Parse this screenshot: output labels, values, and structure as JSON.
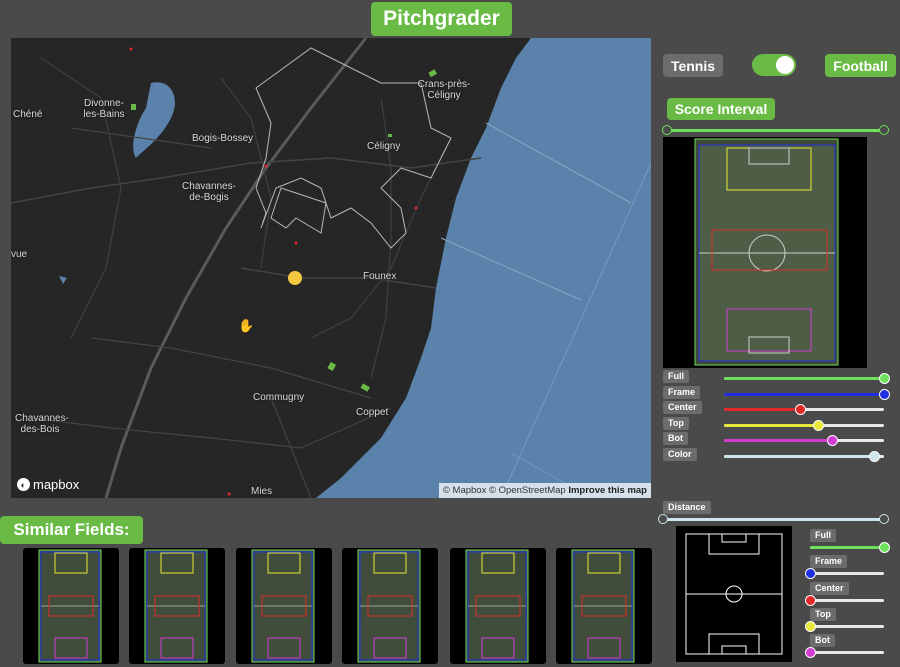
{
  "app": {
    "title": "Pitchgrader"
  },
  "map": {
    "labels": [
      "Chéné",
      "Divonne-les-Bains",
      "Bogis-Bossey",
      "Chavannes-de-Bogis",
      "Crans-près-Céligny",
      "Céligny",
      "vue",
      "Founex",
      "Commugny",
      "Coppet",
      "Chavannes-des-Bois",
      "Mies"
    ],
    "logo": "mapbox",
    "attribution": "© Mapbox © OpenStreetMap",
    "improve_link": "Improve this map",
    "colors": {
      "land": "#262626",
      "water": "#5a82aa",
      "field": "#6abb45",
      "marker": "#f5c842",
      "road": "#555555"
    }
  },
  "sport_toggle": {
    "left_label": "Tennis",
    "right_label": "Football",
    "selected": "Football"
  },
  "score_interval": {
    "label": "Score Interval",
    "range": [
      0,
      1
    ]
  },
  "filters": [
    {
      "label": "Full",
      "color": "#6ee05a",
      "value": 1.0
    },
    {
      "label": "Frame",
      "color": "#1f2ee0",
      "value": 1.0
    },
    {
      "label": "Center",
      "color": "#e02a2a",
      "value": 0.48
    },
    {
      "label": "Top",
      "color": "#e8e83a",
      "value": 0.59
    },
    {
      "label": "Bot",
      "color": "#d23bd2",
      "value": 0.68
    },
    {
      "label": "Color",
      "color": "#cfe6ee",
      "value": 0.94
    }
  ],
  "similar_fields": {
    "label": "Similar Fields:",
    "count": 6
  },
  "distance": {
    "label": "Distance",
    "range": [
      0,
      1
    ],
    "weights": [
      {
        "label": "Full",
        "color": "#6ee05a",
        "value": 1.0
      },
      {
        "label": "Frame",
        "color": "#1f2ee0",
        "value": 0.0
      },
      {
        "label": "Center",
        "color": "#e02a2a",
        "value": 0.0
      },
      {
        "label": "Top",
        "color": "#e8e83a",
        "value": 0.0
      },
      {
        "label": "Bot",
        "color": "#d23bd2",
        "value": 0.0
      }
    ]
  }
}
